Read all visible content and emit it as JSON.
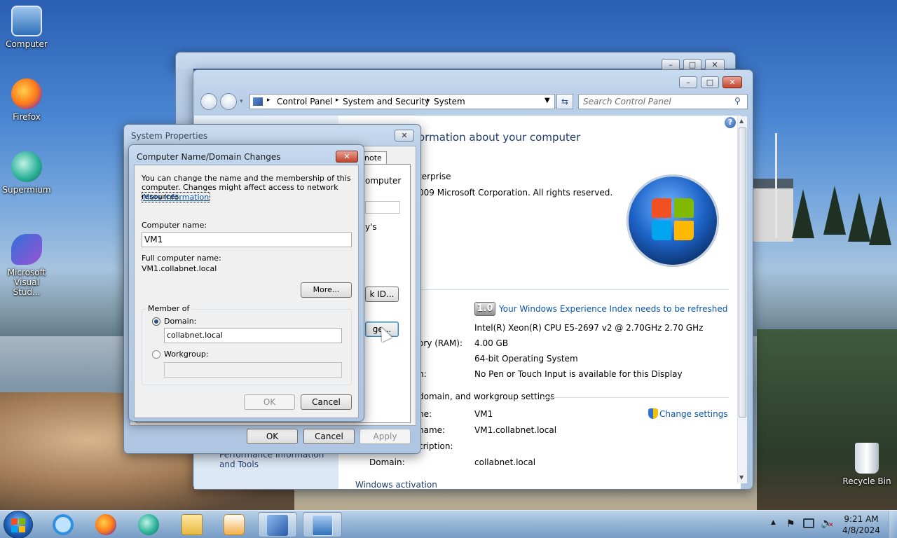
{
  "desktop": {
    "icons": [
      {
        "label": "Computer"
      },
      {
        "label": "Firefox"
      },
      {
        "label": "Supermium"
      },
      {
        "label": "Microsoft Visual Stud..."
      },
      {
        "label": "Recycle Bin"
      }
    ]
  },
  "control_panel": {
    "address": {
      "root": "Control Panel",
      "crumb2": "System and Security",
      "crumb3": "System"
    },
    "search_placeholder": "Search Control Panel",
    "heading_partial": "ormation about your computer",
    "edition_partial": "terprise",
    "copyright_partial": "009 Microsoft Corporation.  All rights reserved.",
    "rating_badge": "1.0",
    "rating_link": "Your Windows Experience Index needs to be refreshed",
    "processor_value": "Intel(R) Xeon(R) CPU E5-2697 v2 @ 2.70GHz  2.70 GHz",
    "ram_label_partial": "ory (RAM):",
    "ram_value": "4.00 GB",
    "system_type_value": "64-bit Operating System",
    "pen_label_partial": "h:",
    "pen_value": "No Pen or Touch Input is available for this Display",
    "section_partial": "domain, and workgroup settings",
    "computer_name_label_partial": "ne:",
    "computer_name_value": "VM1",
    "full_name_label_partial": "name:",
    "full_name_value": "VM1.collabnet.local",
    "description_label_partial": "cription:",
    "domain_label": "Domain:",
    "domain_value": "collabnet.local",
    "change_settings": "Change settings",
    "left_pane_link": "Performance Information and Tools",
    "bottom_partial": "Windows activation"
  },
  "system_properties": {
    "title": "System Properties",
    "tab_partial": "note",
    "frag_computer": "omputer",
    "frag_ys": "y's",
    "network_id_btn_partial": "k ID...",
    "change_btn_partial": "ge...",
    "ok": "OK",
    "cancel": "Cancel",
    "apply": "Apply"
  },
  "name_dialog": {
    "title": "Computer Name/Domain Changes",
    "intro": "You can change the name and the membership of this computer. Changes might affect access to network resources.",
    "more_info": "More information",
    "computer_name_label": "Computer name:",
    "computer_name_value": "VM1",
    "full_name_label": "Full computer name:",
    "full_name_value": "VM1.collabnet.local",
    "more_btn": "More...",
    "member_of": "Member of",
    "domain_label": "Domain:",
    "domain_value": "collabnet.local",
    "workgroup_label": "Workgroup:",
    "workgroup_value": "",
    "ok": "OK",
    "cancel": "Cancel"
  },
  "tray": {
    "time": "9:21 AM",
    "date": "4/8/2024"
  }
}
